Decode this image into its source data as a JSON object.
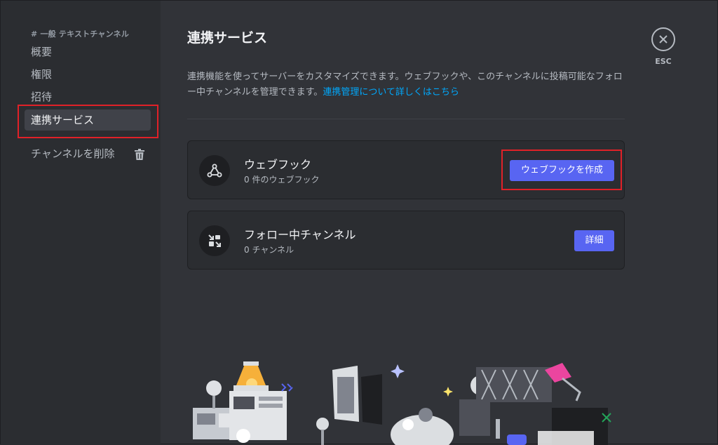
{
  "sidebar": {
    "header": "# 一般 テキストチャンネル",
    "items": [
      {
        "label": "概要"
      },
      {
        "label": "権限"
      },
      {
        "label": "招待"
      },
      {
        "label": "連携サービス"
      }
    ],
    "delete_label": "チャンネルを削除"
  },
  "main": {
    "title": "連携サービス",
    "description": "連携機能を使ってサーバーをカスタマイズできます。ウェブフックや、このチャンネルに投稿可能なフォロー中チャンネルを管理できます。",
    "link_text": "連携管理について詳しくはこちら",
    "cards": [
      {
        "title": "ウェブフック",
        "subtitle": "0 件のウェブフック",
        "button": "ウェブフックを作成"
      },
      {
        "title": "フォロー中チャンネル",
        "subtitle": "0 チャンネル",
        "button": "詳細"
      }
    ]
  },
  "esc": {
    "label": "ESC"
  },
  "colors": {
    "accent": "#5865f2",
    "link": "#00a8fc",
    "highlight": "#e02128"
  }
}
